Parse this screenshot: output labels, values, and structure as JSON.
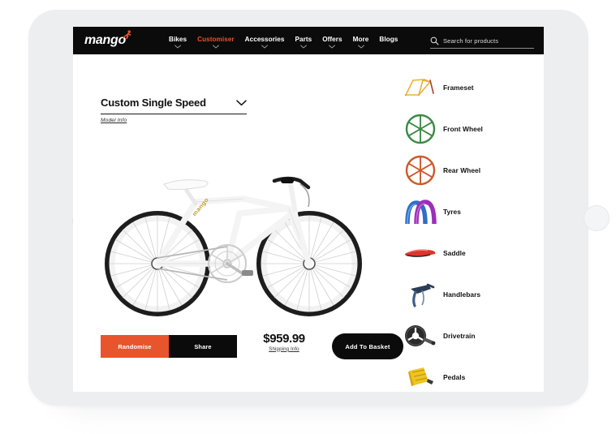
{
  "device": {
    "type": "tablet",
    "bezel_color": "#edeef0",
    "home_button": "home-button",
    "camera": "front-camera"
  },
  "theme": {
    "accent": "#e8542b",
    "dark": "#0b0b0b",
    "text": "#111111"
  },
  "nav": {
    "logo_text": "mango",
    "logo_icon": "cyclist-icon",
    "items": [
      {
        "label": "Bikes",
        "active": false,
        "has_dropdown": true
      },
      {
        "label": "Customiser",
        "active": true,
        "has_dropdown": true
      },
      {
        "label": "Accessories",
        "active": false,
        "has_dropdown": true
      },
      {
        "label": "Parts",
        "active": false,
        "has_dropdown": true
      },
      {
        "label": "Offers",
        "active": false,
        "has_dropdown": true
      },
      {
        "label": "More",
        "active": false,
        "has_dropdown": true
      },
      {
        "label": "Blogs",
        "active": false,
        "has_dropdown": false
      }
    ],
    "search": {
      "placeholder": "Search for products",
      "value": "",
      "icon": "search-icon"
    }
  },
  "product": {
    "title": "Custom Single Speed",
    "title_dropdown_icon": "chevron-down-icon",
    "model_info_link": "Model Info",
    "image_alt": "white single speed bicycle",
    "price": "$959.99",
    "shipping_link": "Shipping Info",
    "buttons": {
      "randomise": "Randomise",
      "share": "Share",
      "add_to_basket": "Add To Basket"
    }
  },
  "parts": [
    {
      "label": "Frameset",
      "icon": "frameset-icon",
      "color": "#e8b23a"
    },
    {
      "label": "Front Wheel",
      "icon": "front-wheel-icon",
      "color": "#3c8a46"
    },
    {
      "label": "Rear Wheel",
      "icon": "rear-wheel-icon",
      "color": "#cc5a2b"
    },
    {
      "label": "Tyres",
      "icon": "tyres-icon",
      "color": "#2f6fc4"
    },
    {
      "label": "Saddle",
      "icon": "saddle-icon",
      "color": "#e0332b"
    },
    {
      "label": "Handlebars",
      "icon": "handlebars-icon",
      "color": "#3d5f86"
    },
    {
      "label": "Drivetrain",
      "icon": "drivetrain-icon",
      "color": "#2b2b2b"
    },
    {
      "label": "Pedals",
      "icon": "pedals-icon",
      "color": "#f0c521"
    }
  ]
}
